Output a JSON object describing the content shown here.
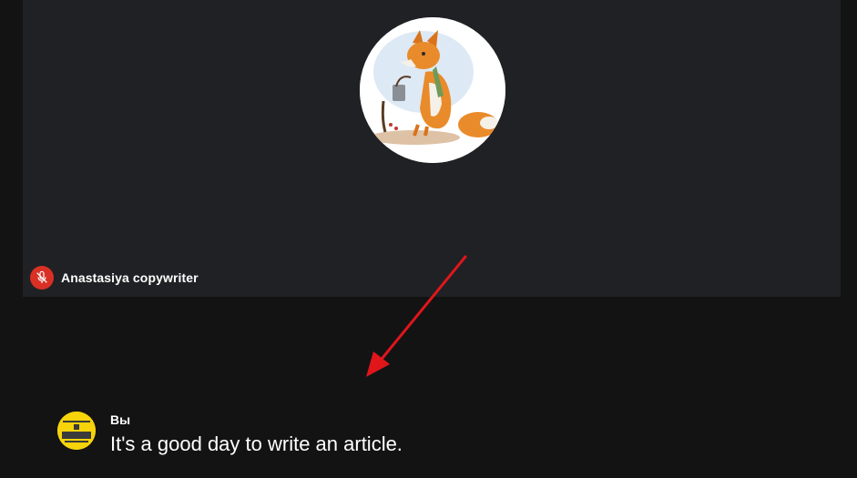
{
  "participant": {
    "name": "Anastasiya copywriter",
    "mic_status_icon": "mic-off-icon",
    "avatar_icon": "fox-illustration-avatar"
  },
  "caption": {
    "speaker": "Вы",
    "text": "It's a good day to write an article.",
    "avatar_icon": "yellow-profile-avatar"
  },
  "colors": {
    "tile_background": "#202124",
    "page_background": "#131314",
    "mic_off_red": "#d93025",
    "annotation_arrow": "#e0161b",
    "speaker_avatar_yellow": "#f6d30a"
  }
}
